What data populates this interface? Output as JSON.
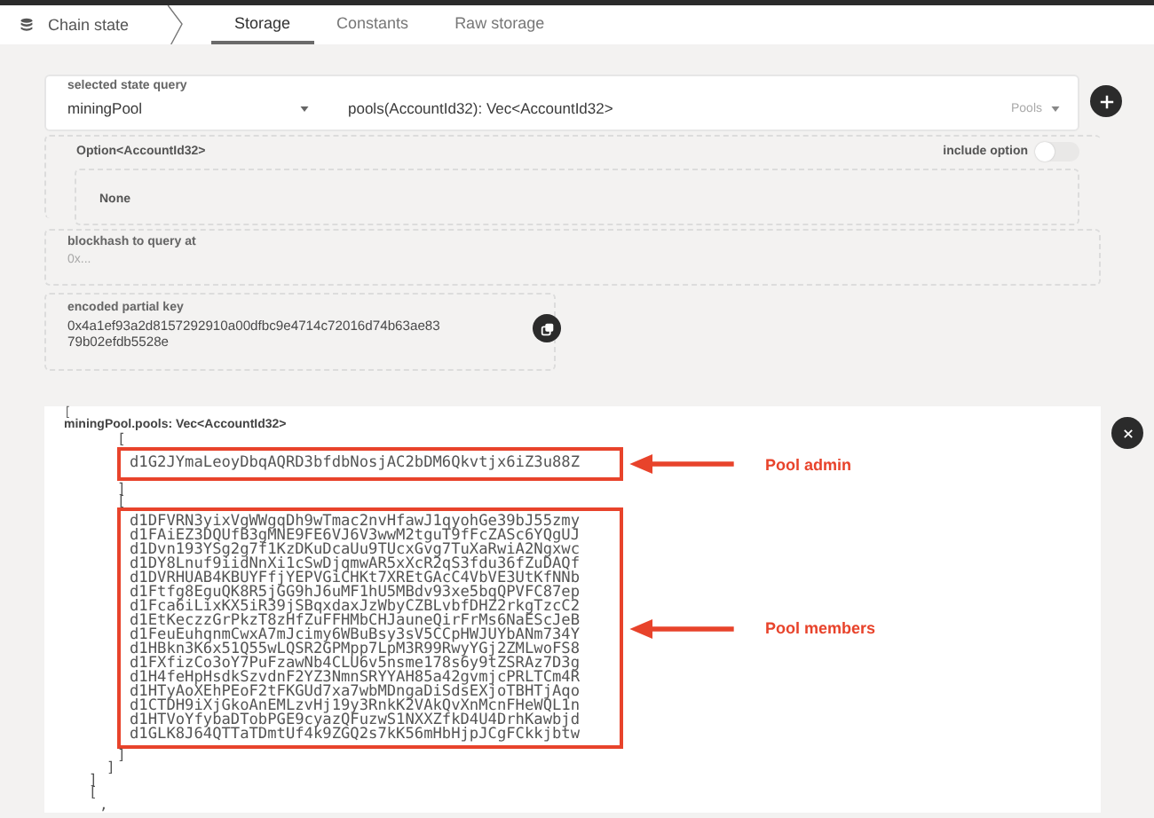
{
  "breadcrumb": {
    "label": "Chain state"
  },
  "tabs": [
    {
      "label": "Storage",
      "selected": true
    },
    {
      "label": "Constants",
      "selected": false
    },
    {
      "label": "Raw storage",
      "selected": false
    }
  ],
  "query": {
    "label": "selected state query",
    "module": "miningPool",
    "method": "pools(AccountId32): Vec<AccountId32>",
    "method_hint": "Pools"
  },
  "param": {
    "label": "Option<AccountId32>",
    "include_option_label": "include option",
    "include_option": false,
    "value": "None"
  },
  "blockhash": {
    "label": "blockhash to query at",
    "placeholder": "0x..."
  },
  "encoded_key": {
    "label": "encoded partial key",
    "lines": [
      "0x4a1ef93a2d8157292910a00dfbc9e4714c72016d74b63ae83",
      "79b02efdb5528e"
    ]
  },
  "result": {
    "lead": "[",
    "title": "miningPool.pools: Vec<AccountId32>",
    "admin": {
      "open": "[",
      "address": "d1G2JYmaLeoyDbqAQRD3bfdbNosjAC2bDM6Qkvtjx6iZ3u88Z",
      "close": "]",
      "annotation": "Pool admin"
    },
    "members": {
      "open": "[",
      "addresses": [
        "d1DFVRN3yixVgWWgqDh9wTmac2nvHfawJ1qyohGe39bJ55zmy",
        "d1FAiEZ3DQUfB3gMNE9FE6VJ6V3wwM2tguT9fFcZASc6YQgUJ",
        "d1Dvn193YSg2g7f1KzDKuDcaUu9TUcxGvg7TuXaRwiA2Ngxwc",
        "d1DY8Lnuf9iidNnXi1cSwDjqmwAR5xXcR2qS3fdu36fZuDAQf",
        "d1DVRHUAB4KBUYFfjYEPVGiCHKt7XREtGAcC4VbVE3UtKfNNb",
        "d1Ftfg8EguQK8R5jGG9hJ6uMF1hU5MBdv93xe5bqQPVFC87ep",
        "d1Fca6iLixKX5iR39jSBqxdaxJzWbyCZBLvbfDHZ2rkgTzcC2",
        "d1EtKeczzGrPkzT8zHfZuFFHMbCHJauneQirFrMs6NaEScJeB",
        "d1FeuEuhqnmCwxA7mJcimy6WBuBsy3sV5CCpHWJUYbANm734Y",
        "d1HBkn3K6x51Q55wLQSR2GPMpp7LpM3R99RwyYGj2ZMLwoFS8",
        "d1FXfizCo3oY7PuFzawNb4CLU6v5nsme178s6y9tZSRAz7D3g",
        "d1H4feHpHsdkSzvdnF2YZ3NmnSRYYAH85a42gvmjcPRLTCm4R",
        "d1HTyAoXEhPEoF2tFKGUd7xa7wbMDngaDiSdsEXjoTBHTjAqo",
        "d1CTDH9iXjGkoAnEMLzvHj19y3RnkK2VAkQvXnMcnFHeWQL1n",
        "d1HTVoYfybaDTobPGE9cyazQFuzwS1NXXZfkD4U4DrhKawbjd",
        "d1GLK8J64QTTaTDmtUf4k9ZGQ2s7kK56mHbHjpJCgFCkkjbtw"
      ],
      "close": "]",
      "annotation": "Pool members"
    },
    "tail": [
      "]",
      "]",
      "[",
      ","
    ]
  }
}
